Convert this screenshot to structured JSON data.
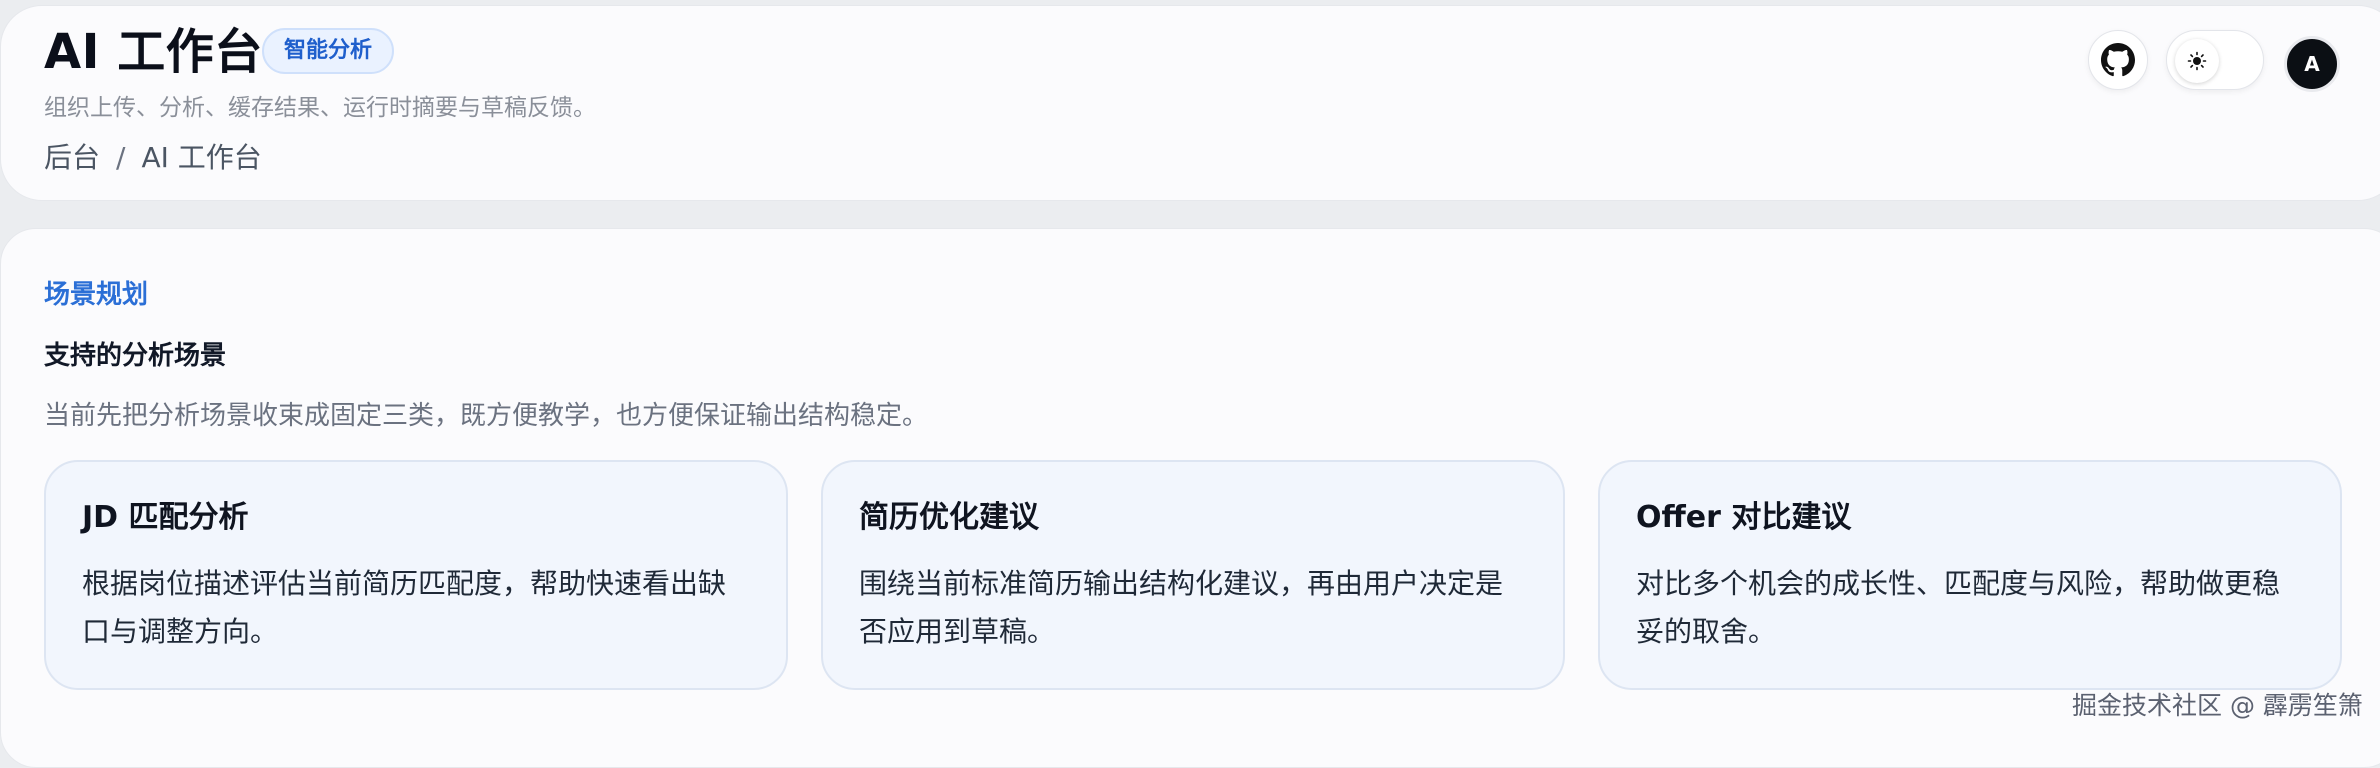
{
  "header": {
    "title": "AI 工作台",
    "badge": "智能分析",
    "subtitle": "组织上传、分析、缓存结果、运行时摘要与草稿反馈。",
    "breadcrumb": [
      "后台",
      "AI 工作台"
    ],
    "breadcrumb_separator": "/",
    "avatar_initial": "A",
    "theme_icon": "sun-icon",
    "github_icon": "github-icon"
  },
  "section": {
    "eyebrow": "场景规划",
    "heading": "支持的分析场景",
    "description": "当前先把分析场景收束成固定三类，既方便教学，也方便保证输出结构稳定。"
  },
  "scenarios": [
    {
      "title": "JD 匹配分析",
      "description": "根据岗位描述评估当前简历匹配度，帮助快速看出缺口与调整方向。"
    },
    {
      "title": "简历优化建议",
      "description": "围绕当前标准简历输出结构化建议，再由用户决定是否应用到草稿。"
    },
    {
      "title": "Offer 对比建议",
      "description": "对比多个机会的成长性、匹配度与风险，帮助做更稳妥的取舍。"
    }
  ],
  "watermark": "掘金技术社区 @ 霹雳笙箫",
  "colors": {
    "accent": "#2b6fd6",
    "badge_bg": "#eaf2ff",
    "card_bg": "#f2f6fd"
  }
}
